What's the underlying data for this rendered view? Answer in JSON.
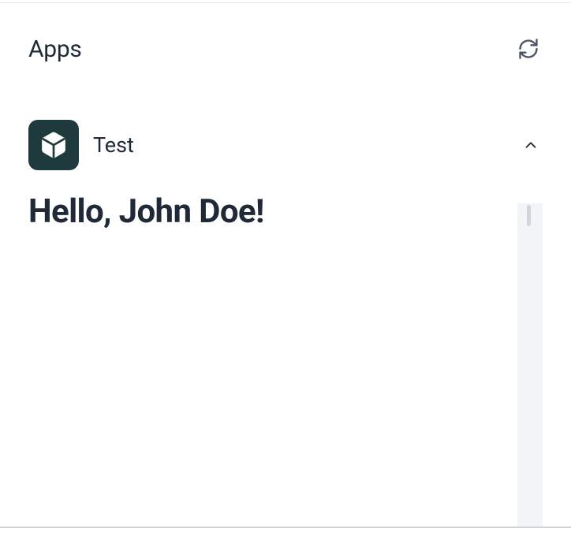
{
  "header": {
    "title": "Apps"
  },
  "app": {
    "name": "Test",
    "greeting": "Hello, John Doe!"
  },
  "icons": {
    "refresh": "refresh-icon",
    "cube": "cube-icon",
    "chevronUp": "chevron-up-icon"
  },
  "colors": {
    "iconBg": "#1f3a3d",
    "text": "#1f2937"
  }
}
